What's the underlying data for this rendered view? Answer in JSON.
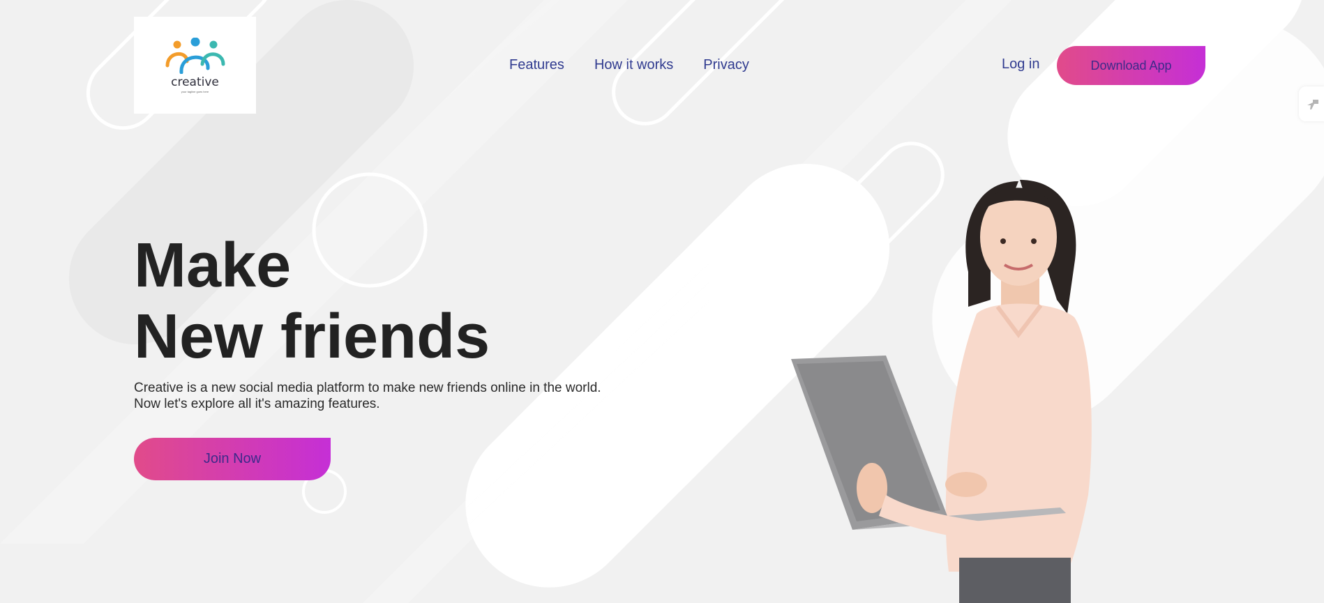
{
  "brand": {
    "name": "creative",
    "tagline": "your tagline goes here"
  },
  "nav": {
    "items": [
      "Features",
      "How it works",
      "Privacy"
    ]
  },
  "header": {
    "login_label": "Log in",
    "download_label": "Download App"
  },
  "hero": {
    "title_line1": "Make",
    "title_line2": "New friends",
    "description_line1": "Creative is a new social media platform to make new friends online in the world.",
    "description_line2": "Now let's explore all it's amazing features.",
    "cta_label": "Join Now"
  },
  "colors": {
    "nav_text": "#2f3a8f",
    "button_gradient_start": "#e14b8a",
    "button_gradient_end": "#c52fd6",
    "title_text": "#222222",
    "background": "#f1f1f1",
    "logo_orange": "#f39c2a",
    "logo_blue": "#2a9ed8",
    "logo_teal": "#3bb8b0"
  },
  "icons": {
    "side_tab": "tool-icon"
  }
}
